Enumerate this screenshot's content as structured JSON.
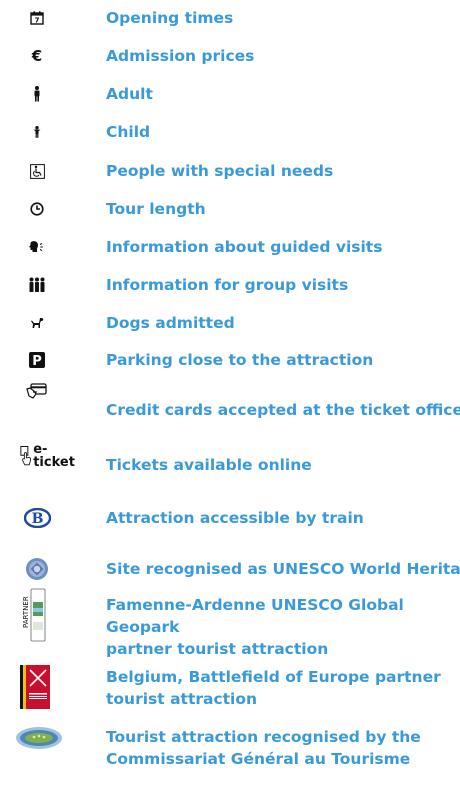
{
  "legend": {
    "items": [
      {
        "id": "opening",
        "label": "Opening times",
        "icon": "calendar-icon"
      },
      {
        "id": "admission",
        "label": "Admission prices",
        "icon": "euro-icon"
      },
      {
        "id": "adult",
        "label": "Adult",
        "icon": "adult-icon"
      },
      {
        "id": "child",
        "label": "Child",
        "icon": "child-icon"
      },
      {
        "id": "special-needs",
        "label": "People with special needs",
        "icon": "wheelchair-icon"
      },
      {
        "id": "tour-length",
        "label": "Tour length",
        "icon": "clock-icon"
      },
      {
        "id": "guided",
        "label": "Information about guided visits",
        "icon": "guide-speaker-icon"
      },
      {
        "id": "group",
        "label": "Information for group visits",
        "icon": "group-icon"
      },
      {
        "id": "dogs",
        "label": "Dogs admitted",
        "icon": "dog-icon"
      },
      {
        "id": "parking",
        "label": "Parking close to the attraction",
        "icon": "parking-icon"
      },
      {
        "id": "credit",
        "label": "Credit cards accepted at the ticket office",
        "icon": "credit-card-icon"
      },
      {
        "id": "eticket",
        "label": "Tickets available online",
        "icon": "e-ticket-icon",
        "icon_text": "e-ticket"
      },
      {
        "id": "train",
        "label": "Attraction accessible by train",
        "icon": "train-sncb-icon",
        "icon_text": "B"
      },
      {
        "id": "unesco",
        "label": "Site recognised as UNESCO World Heritage",
        "icon": "unesco-heritage-icon"
      },
      {
        "id": "geopark",
        "label_lines": [
          "Famenne-Ardenne UNESCO Global Geopark",
          "partner tourist attraction"
        ],
        "icon": "geopark-partner-icon",
        "icon_text": "PARTNER",
        "icon_caption": "Famenne Ardenne"
      },
      {
        "id": "battlefield",
        "label_lines": [
          "Belgium, Battlefield of Europe partner",
          "tourist attraction"
        ],
        "icon": "battlefield-europe-icon",
        "icon_caption": "BELGIUM BATTLEFIELD OF EUROPE"
      },
      {
        "id": "cgt",
        "label_lines": [
          "Tourist attraction recognised by the",
          "Commissariat Général au Tourisme"
        ],
        "icon": "cgt-recognition-icon"
      }
    ]
  }
}
